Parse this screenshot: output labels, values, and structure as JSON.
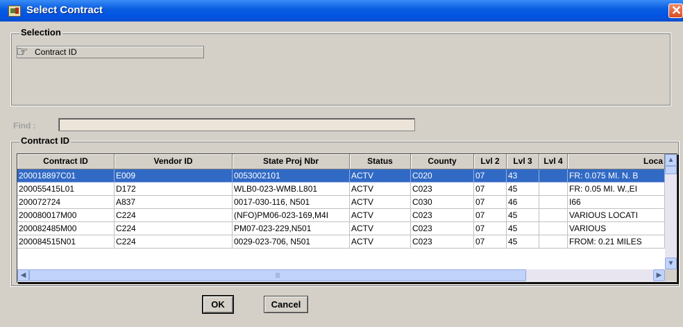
{
  "window": {
    "title": "Select Contract",
    "close_glyph": "✕"
  },
  "selection": {
    "legend": "Selection",
    "item_label": "Contract ID",
    "icon": "pointing-hand-icon"
  },
  "find": {
    "label": "Find :",
    "value": ""
  },
  "contract_group": {
    "legend": "Contract ID"
  },
  "table": {
    "columns": [
      "Contract ID",
      "Vendor ID",
      "State Proj Nbr",
      "Status",
      "County",
      "Lvl 2",
      "Lvl 3",
      "Lvl 4",
      "Loca"
    ],
    "rows": [
      [
        "200018897C01",
        "E009",
        "0053002101",
        "ACTV",
        "C020",
        "07",
        "43",
        "",
        "FR: 0.075 MI. N. B"
      ],
      [
        "200055415L01",
        "D172",
        "WLB0-023-WMB.L801",
        "ACTV",
        "C023",
        "07",
        "45",
        "",
        "FR: 0.05 MI. W.,EI"
      ],
      [
        "200072724",
        "A837",
        "0017-030-116, N501",
        "ACTV",
        "C030",
        "07",
        "46",
        "",
        "I66"
      ],
      [
        "200080017M00",
        "C224",
        "(NFO)PM06-023-169,M4I",
        "ACTV",
        "C023",
        "07",
        "45",
        "",
        "VARIOUS LOCATI"
      ],
      [
        "200082485M00",
        "C224",
        "PM07-023-229,N501",
        "ACTV",
        "C023",
        "07",
        "45",
        "",
        "VARIOUS"
      ],
      [
        "200084515N01",
        "C224",
        "0029-023-706, N501",
        "ACTV",
        "C023",
        "07",
        "45",
        "",
        "FROM: 0.21 MILES"
      ]
    ],
    "selected_row": 0
  },
  "buttons": {
    "ok": "OK",
    "cancel": "Cancel"
  },
  "colors": {
    "titlebar": "#0054e3",
    "selection_highlight": "#316ac5",
    "dialog_face": "#d4d0c8"
  }
}
